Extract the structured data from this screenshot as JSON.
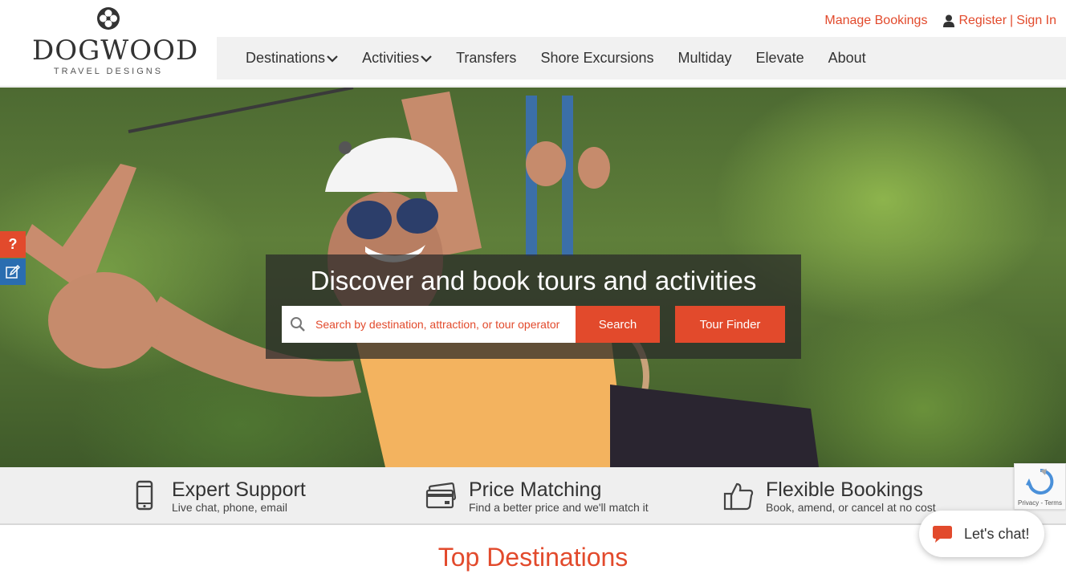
{
  "brand": {
    "name": "DOGWOOD",
    "tagline": "TRAVEL DESIGNS"
  },
  "toplinks": {
    "manage_bookings": "Manage Bookings",
    "register": "Register",
    "separator": "|",
    "sign_in": "Sign In"
  },
  "nav": {
    "items": [
      {
        "label": "Destinations"
      },
      {
        "label": "Activities"
      },
      {
        "label": "Transfers"
      },
      {
        "label": "Shore Excursions"
      },
      {
        "label": "Multiday"
      },
      {
        "label": "Elevate"
      },
      {
        "label": "About"
      }
    ]
  },
  "hero": {
    "title": "Discover and book tours and activities",
    "search_placeholder": "Search by destination, attraction, or tour operator",
    "search_button": "Search",
    "tour_finder_button": "Tour Finder"
  },
  "side_tabs": {
    "help": "?"
  },
  "features": [
    {
      "title": "Expert Support",
      "subtitle": "Live chat, phone, email",
      "icon": "phone-icon"
    },
    {
      "title": "Price Matching",
      "subtitle": "Find a better price and we'll match it",
      "icon": "credit-card-icon"
    },
    {
      "title": "Flexible Bookings",
      "subtitle": "Book, amend, or cancel at no cost",
      "icon": "thumbs-up-icon"
    }
  ],
  "recaptcha": {
    "text": "Privacy - Terms"
  },
  "chat": {
    "label": "Let's chat!"
  },
  "sections": {
    "top_destinations": "Top Destinations"
  },
  "colors": {
    "accent": "#e24a2c",
    "nav_bg": "#f1f1f1",
    "features_bg": "#efefef",
    "edit_tab": "#2a6db0"
  }
}
